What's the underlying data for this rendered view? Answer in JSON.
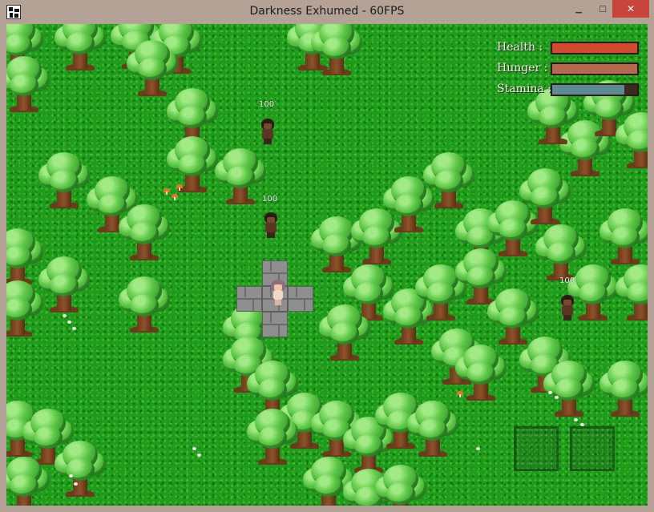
{
  "window": {
    "title": "Darkness Exhumed - 60FPS",
    "buttons": {
      "minimize": "▁",
      "maximize": "☐",
      "close": "✕"
    }
  },
  "hud": {
    "health": {
      "label": "Health :",
      "value": 1.0,
      "color": "#d24a2e"
    },
    "hunger": {
      "label": "Hunger :",
      "value": 1.0,
      "color": "#b36a4e"
    },
    "stamina": {
      "label": "Stamina :",
      "value": 0.85,
      "color": "#5e8a94"
    }
  },
  "npcs": [
    {
      "hp": "100"
    },
    {
      "hp": "100"
    },
    {
      "hp": "100"
    }
  ],
  "inventory": {
    "slots": 2
  },
  "colors": {
    "grass": "#1f9c1c",
    "frame": "#b4a296",
    "close_button": "#c7453b"
  }
}
